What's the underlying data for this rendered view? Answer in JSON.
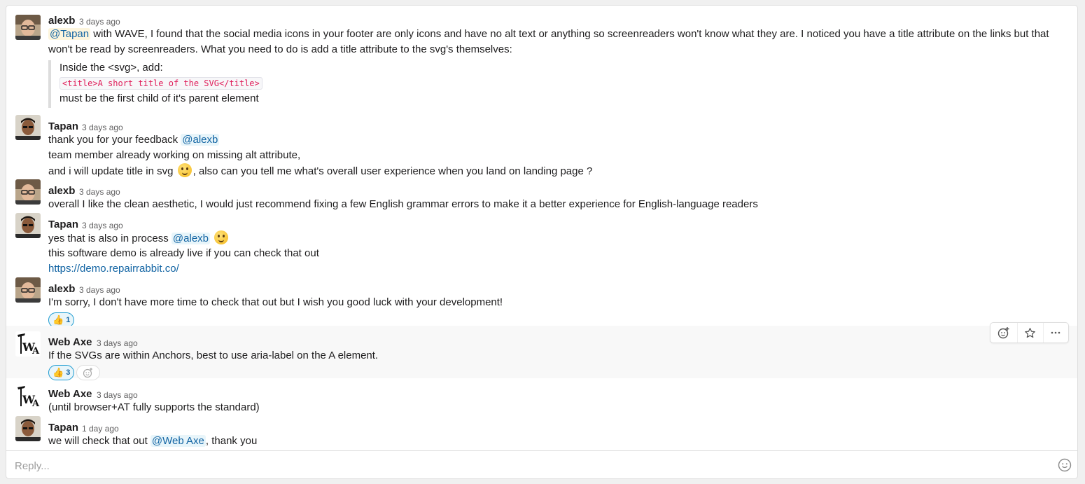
{
  "messages": [
    {
      "author": "alexb",
      "time": "3 days ago",
      "mention": "@Tapan",
      "text1": " with WAVE, I found that the social media icons in your footer are only icons and have no alt text or anything so screenreaders won't know what they are. I noticed you have a title attribute on the links but that",
      "text2": "won't be read by screenreaders. What you need to do is add a title attribute to the svg's themselves:",
      "quote1": "Inside the <svg>, add:",
      "quote_code": "<title>A short title of the SVG</title>",
      "quote3": "must be the first child of it's parent element"
    },
    {
      "author": "Tapan",
      "time": "3 days ago",
      "line1": "thank you for your feedback ",
      "mention": "@alexb",
      "line2": "team member already working on missing alt attribute,",
      "line3a": "and i will update title in svg ",
      "line3b": ",  also can you tell me what's overall user experience when you land on landing page ?"
    },
    {
      "author": "alexb",
      "time": "3 days ago",
      "line1": "overall I like the clean aesthetic, I would just recommend fixing a few English grammar errors to make it a better experience for English-language readers"
    },
    {
      "author": "Tapan",
      "time": "3 days ago",
      "line1": "yes that is also in process ",
      "mention": "@alexb",
      "line2": "this software demo is already live if you can check that out",
      "link": "https://demo.repairrabbit.co/"
    },
    {
      "author": "alexb",
      "time": "3 days ago",
      "line1": "I'm sorry, I don't have more time to check that out but I wish you good luck with your development!",
      "reaction_count": "1"
    },
    {
      "author": "Web Axe",
      "time": "3 days ago",
      "line1": "If the SVGs are within Anchors, best to use aria-label on the A element.",
      "reaction_count": "3"
    },
    {
      "author": "Web Axe",
      "time": "3 days ago",
      "line1": "(until browser+AT fully supports the standard)"
    },
    {
      "author": "Tapan",
      "time": "1 day ago",
      "line1": "we will check that out ",
      "mention": "@Web Axe",
      "line1b": ", thank you"
    }
  ],
  "reply": {
    "placeholder": "Reply..."
  },
  "icons": {
    "toolbar": [
      "add-reaction-icon",
      "star-icon",
      "more-actions-icon"
    ],
    "reaction_emoji": "thumbs-up-icon",
    "reply_emoji": "emoji-icon"
  },
  "colors": {
    "link": "#1264a3",
    "reaction_border": "#1d9bd1",
    "code": "#e01e5a"
  }
}
